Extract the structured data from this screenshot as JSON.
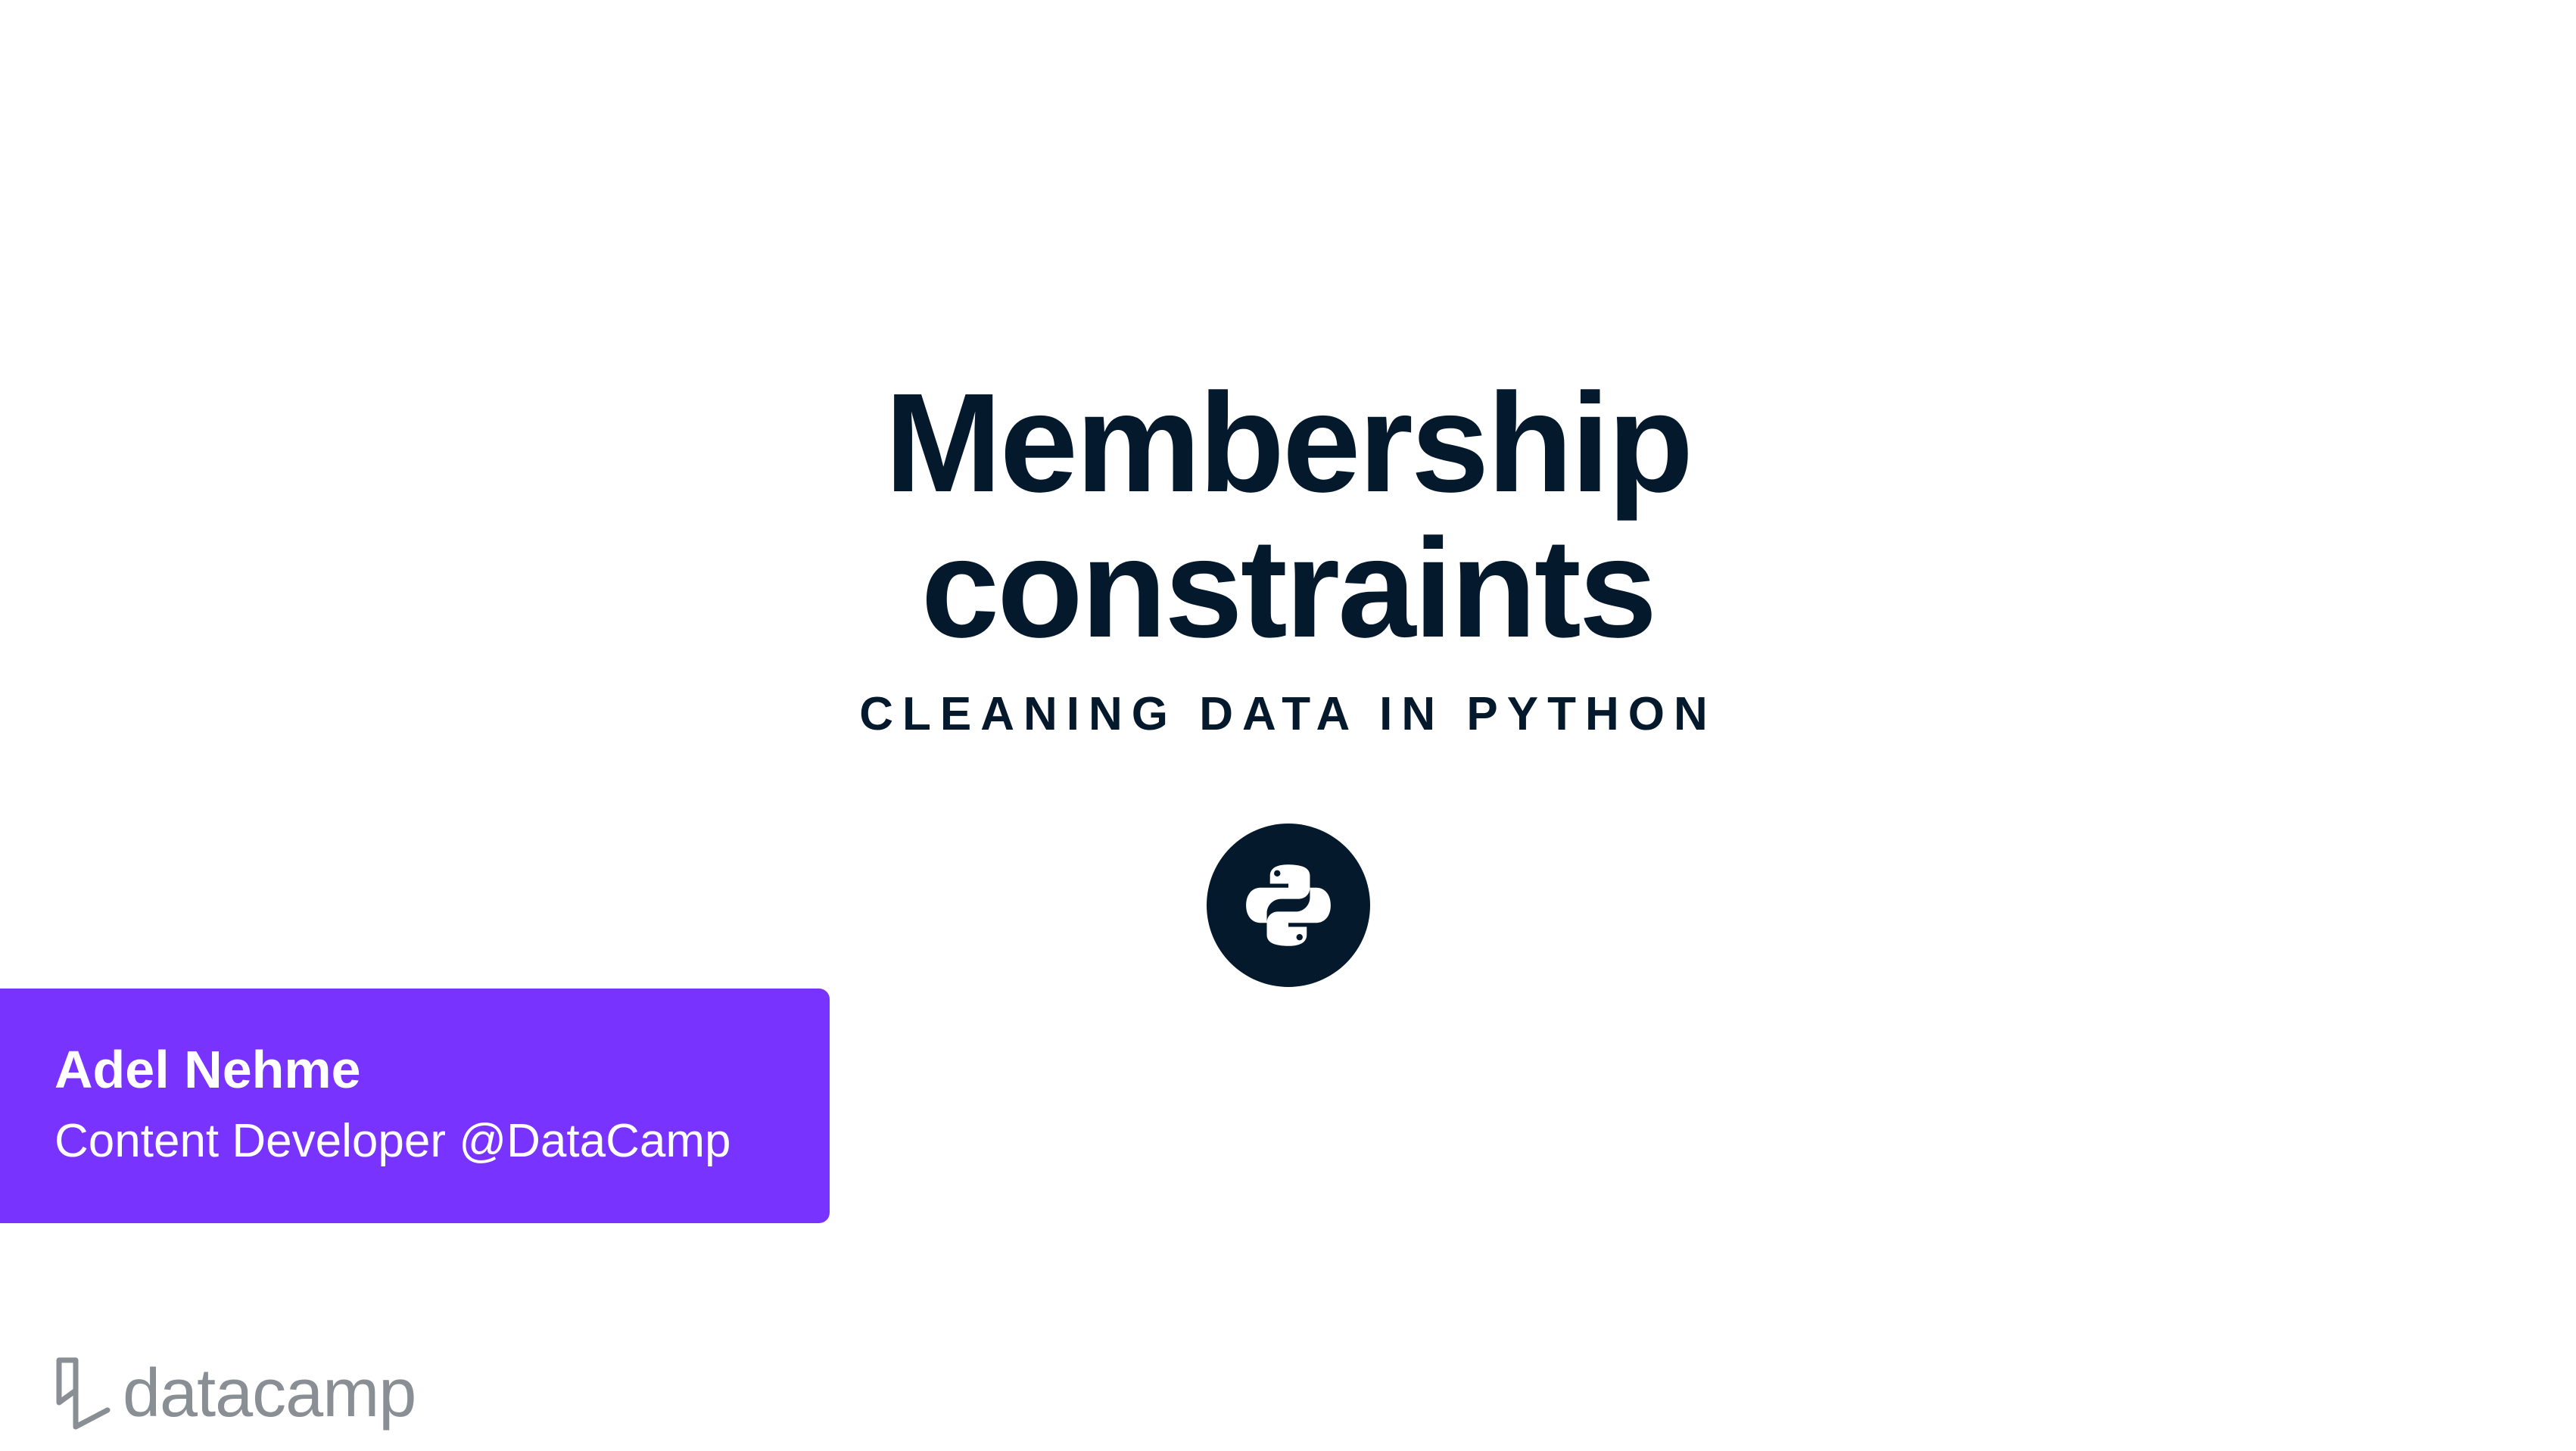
{
  "slide": {
    "title_lines": [
      "Membership",
      "constraints"
    ],
    "subtitle": "CLEANING DATA IN PYTHON",
    "badge_icon": "python-logo-icon",
    "colors": {
      "background": "#ffffff",
      "title": "#05192d",
      "badge": "#05192d",
      "author_card": "#7933ff",
      "logo": "#8a8f96"
    }
  },
  "author": {
    "name": "Adel Nehme",
    "role": "Content Developer @DataCamp"
  },
  "brand": {
    "icon": "datacamp-logo-icon",
    "wordmark": "datacamp"
  }
}
